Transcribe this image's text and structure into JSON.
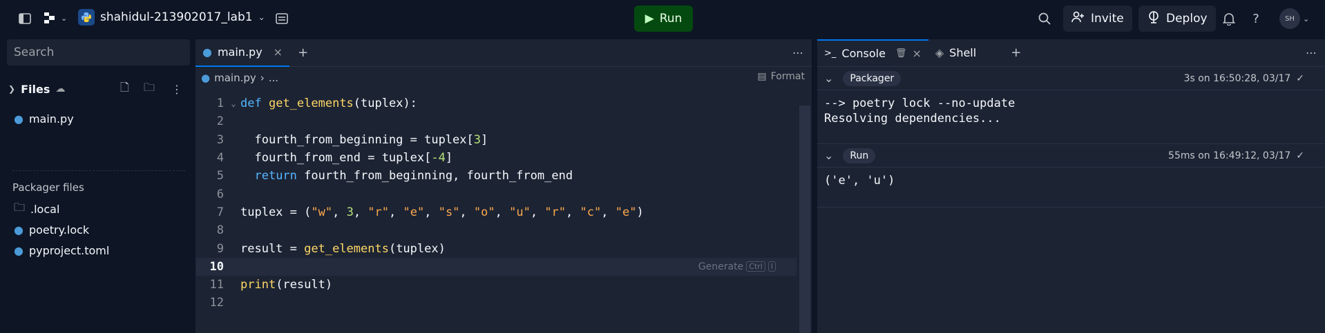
{
  "topbar": {
    "repl_name": "shahidul-213902017_lab1",
    "run_label": "Run",
    "invite_label": "Invite",
    "deploy_label": "Deploy",
    "avatar_initials": "SH"
  },
  "sidebar": {
    "search_placeholder": "Search",
    "files_label": "Files",
    "files": [
      "main.py"
    ],
    "packager_label": "Packager files",
    "packager_files": [
      ".local",
      "poetry.lock",
      "pyproject.toml"
    ]
  },
  "editor": {
    "tab_label": "main.py",
    "breadcrumb_file": "main.py",
    "breadcrumb_more": "...",
    "format_label": "Format",
    "generate_label": "Generate",
    "kbd_ctrl": "Ctrl",
    "kbd_i": "I",
    "active_line": 10,
    "lines": [
      "1",
      "2",
      "3",
      "4",
      "5",
      "6",
      "7",
      "8",
      "9",
      "10",
      "11",
      "12"
    ]
  },
  "console": {
    "tab_console": "Console",
    "tab_shell": "Shell",
    "sections": [
      {
        "chip": "Packager",
        "timing": "3s on 16:50:28, 03/17",
        "output": "--> poetry lock --no-update\nResolving dependencies..."
      },
      {
        "chip": "Run",
        "timing": "55ms on 16:49:12, 03/17",
        "output": "('e', 'u')"
      }
    ]
  },
  "colors": {
    "run_bg": "#044a10",
    "accent": "#0079f2",
    "panel_bg": "#1c2333",
    "app_bg": "#0e1525"
  }
}
